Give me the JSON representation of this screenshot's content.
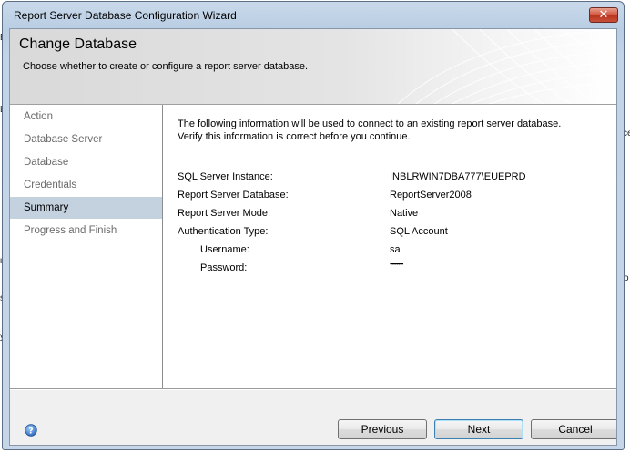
{
  "window": {
    "title": "Report Server Database Configuration Wizard",
    "close_glyph": "✕"
  },
  "header": {
    "title": "Change Database",
    "subtitle": "Choose whether to create or configure a report server database."
  },
  "nav": {
    "items": [
      {
        "label": "Action",
        "selected": false
      },
      {
        "label": "Database Server",
        "selected": false
      },
      {
        "label": "Database",
        "selected": false
      },
      {
        "label": "Credentials",
        "selected": false
      },
      {
        "label": "Summary",
        "selected": true
      },
      {
        "label": "Progress and Finish",
        "selected": false
      }
    ]
  },
  "summary": {
    "intro_line1": "The following information will be used to connect to an existing report server database.",
    "intro_line2": "Verify this information is correct before you continue.",
    "rows": [
      {
        "label": "SQL Server Instance:",
        "value": "INBLRWIN7DBA777\\EUEPRD"
      },
      {
        "label": "Report Server Database:",
        "value": "ReportServer2008"
      },
      {
        "label": "Report Server Mode:",
        "value": "Native"
      },
      {
        "label": "Authentication Type:",
        "value": "SQL Account"
      },
      {
        "label": "Username:",
        "value": "sa"
      },
      {
        "label": "Password:",
        "value": "••••••••"
      }
    ]
  },
  "footer": {
    "help_glyph": "?",
    "previous_label": "Previous",
    "next_label": "Next",
    "cancel_label": "Cancel"
  },
  "background_fragments": [
    "E",
    "LL",
    "ce",
    "ur",
    "s",
    "y",
    "o"
  ],
  "colors": {
    "selected_nav_bg": "#c4d1df",
    "inactive_nav_text": "#6b6b6b",
    "close_button": "#c8503a",
    "help_icon": "#3a78c8"
  }
}
